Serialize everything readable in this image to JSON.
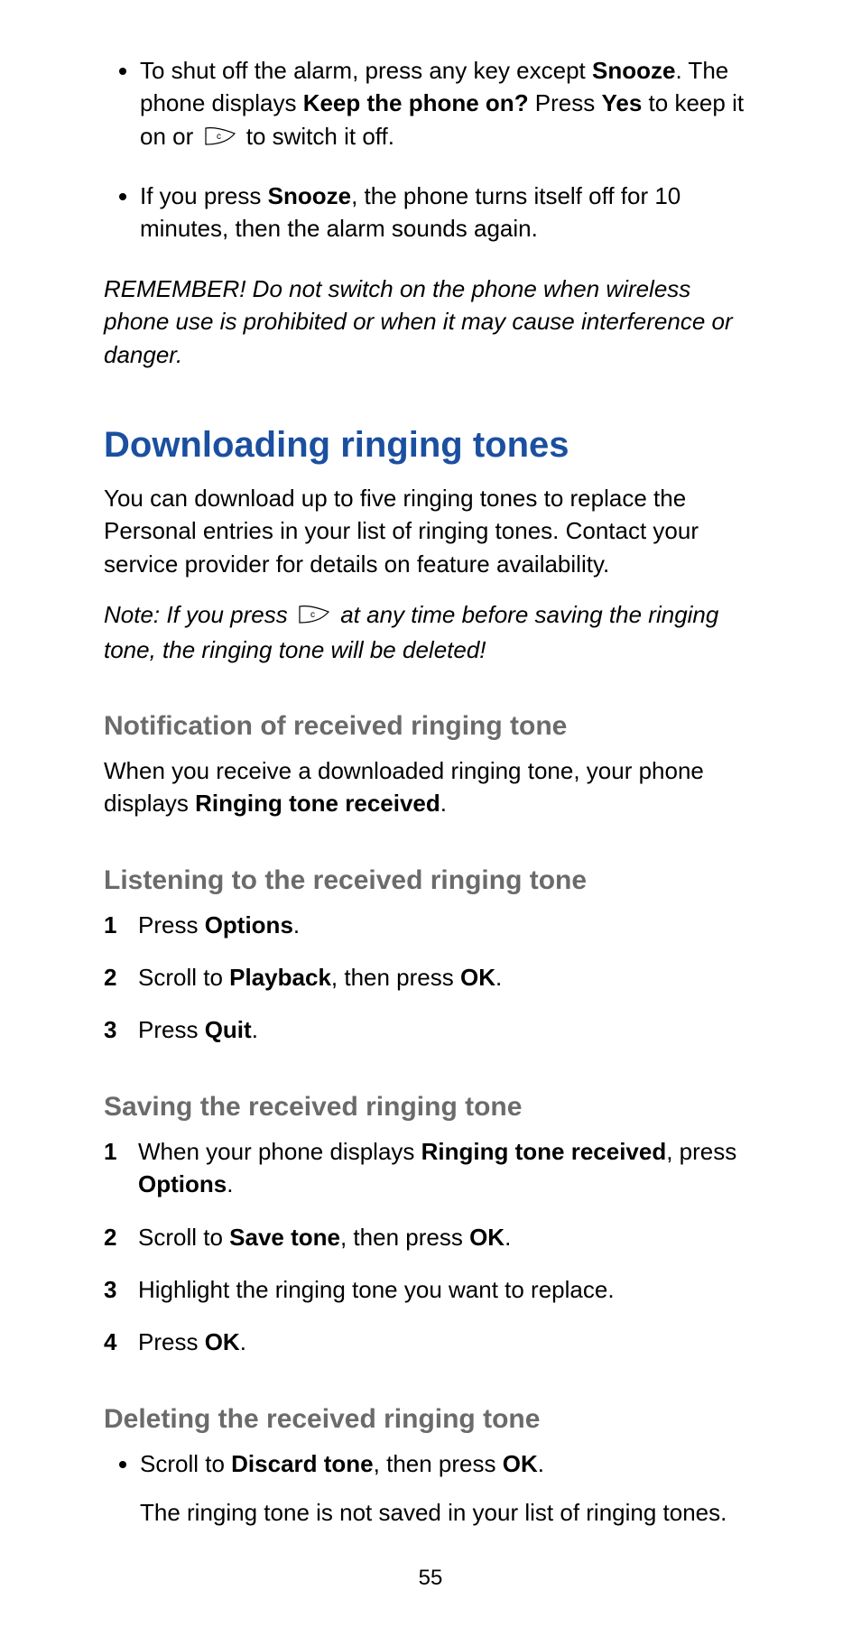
{
  "bullets": {
    "b1_pre": "To shut off the alarm, press any key except ",
    "b1_snooze": "Snooze",
    "b1_after_snooze": ". The phone displays ",
    "b1_keep": "Keep the phone on?",
    "b1_press": " Press ",
    "b1_yes": "Yes",
    "b1_to_keep": " to keep it on or ",
    "b1_switch": " to switch it off.",
    "b2_pre": "If you press ",
    "b2_snooze": "Snooze",
    "b2_rest": ", the phone turns itself off for 10 minutes, then the alarm sounds again."
  },
  "remember": "REMEMBER! Do not switch on the phone when wireless phone use is prohibited or when it may cause interference or danger.",
  "h1": "Downloading ringing tones",
  "intro": "You can download up to five ringing tones to replace the Personal entries in your list of ringing tones. Contact your service provider for details on feature availability.",
  "note_pre": "Note: If you press ",
  "note_post": " at any time before saving the ringing tone, the ringing tone will be deleted!",
  "sub1": {
    "heading": "Notification of received ringing tone",
    "text_pre": "When you receive a downloaded ringing tone, your phone displays ",
    "text_bold": "Ringing tone received",
    "text_post": "."
  },
  "sub2": {
    "heading": "Listening to the received ringing tone",
    "items": {
      "n1": "1",
      "t1_pre": "Press ",
      "t1_b": "Options",
      "t1_post": ".",
      "n2": "2",
      "t2_pre": "Scroll to ",
      "t2_b1": "Playback",
      "t2_mid": ", then press ",
      "t2_b2": "OK",
      "t2_post": ".",
      "n3": "3",
      "t3_pre": "Press ",
      "t3_b": "Quit",
      "t3_post": "."
    }
  },
  "sub3": {
    "heading": "Saving the received ringing tone",
    "items": {
      "n1": "1",
      "t1_pre": "When your phone displays ",
      "t1_b1": "Ringing tone received",
      "t1_mid": ", press ",
      "t1_b2": "Options",
      "t1_post": ".",
      "n2": "2",
      "t2_pre": "Scroll to ",
      "t2_b1": "Save tone",
      "t2_mid": ", then press ",
      "t2_b2": "OK",
      "t2_post": ".",
      "n3": "3",
      "t3": "Highlight the ringing tone you want to replace.",
      "n4": "4",
      "t4_pre": "Press ",
      "t4_b": "OK",
      "t4_post": "."
    }
  },
  "sub4": {
    "heading": "Deleting the received ringing tone",
    "bullet_pre": "Scroll to ",
    "bullet_b1": "Discard tone",
    "bullet_mid": ", then press ",
    "bullet_b2": "OK",
    "bullet_post": ".",
    "follow": "The ringing tone is not saved in your list of ringing tones."
  },
  "page_number": "55"
}
